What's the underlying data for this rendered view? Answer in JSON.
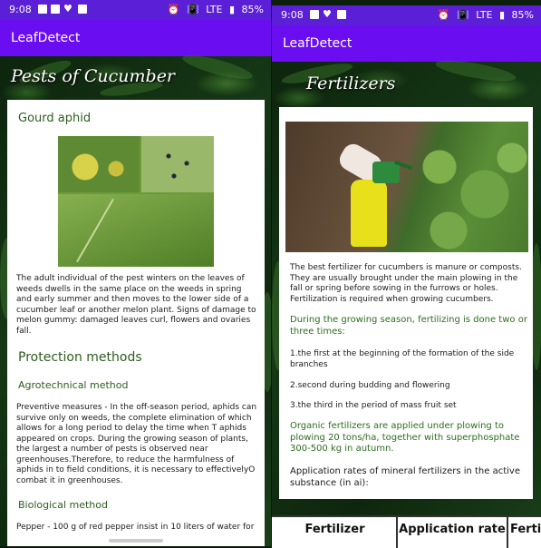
{
  "left": {
    "status": {
      "time": "9:08",
      "network": "LTE",
      "battery": "85%"
    },
    "app_title": "LeafDetect",
    "page_title": "Pests of Cucumber",
    "section1_title": "Gourd aphid",
    "section1_text": "The adult individual of the pest winters on the leaves of weeds dwells in the same place on the weeds in spring and early summer and then moves to the lower side of a cucumber leaf or another melon plant. Signs of damage to melon gummy: damaged leaves curl, flowers and ovaries fall.",
    "section2_title": "Protection methods",
    "sub1_title": "Agrotechnical method",
    "sub1_text": "Preventive measures - In the off-season period, aphids can survive only on weeds, the complete elimination of which allows for a long period to delay the time when T aphids appeared on crops. During the growing season of plants, the largest a number of pests is observed near greenhouses.Therefore, to reduce the harmfulness of aphids in to field conditions, it is necessary to effectivelyO combat it in greenhouses.",
    "sub2_title": "Biological method",
    "sub2_text": "Pepper - 100 g of red pepper insist in 10 liters of water for"
  },
  "right": {
    "status": {
      "time": "9:08",
      "network": "LTE",
      "battery": "85%"
    },
    "app_title": "LeafDetect",
    "page_title": "Fertilizers",
    "intro": "The best fertilizer for cucumbers is manure or composts. They are usually brought under the main plowing in the fall or spring before sowing in the furrows or holes. Fertilization is required when growing cucumbers.",
    "green1": "During the growing season, fertilizing is done two or three times:",
    "item1": "1.the first at the beginning of the formation of the side branches",
    "item2": "2.second during budding and flowering",
    "item3": "3.the third in the period of mass fruit set",
    "green2": "Organic fertilizers are applied under plowing to plowing 20 tons/ha, together with superphosphate 300-500 kg in autumn.",
    "rates": "Application rates of mineral fertilizers in the active substance (in ai):",
    "table_headers": [
      "Fertilizer",
      "Application rate",
      "Fertil"
    ]
  },
  "colors": {
    "statusbar": "#5b1fd8",
    "appbar": "#6a0df0",
    "heading_green": "#2c5e1e"
  }
}
